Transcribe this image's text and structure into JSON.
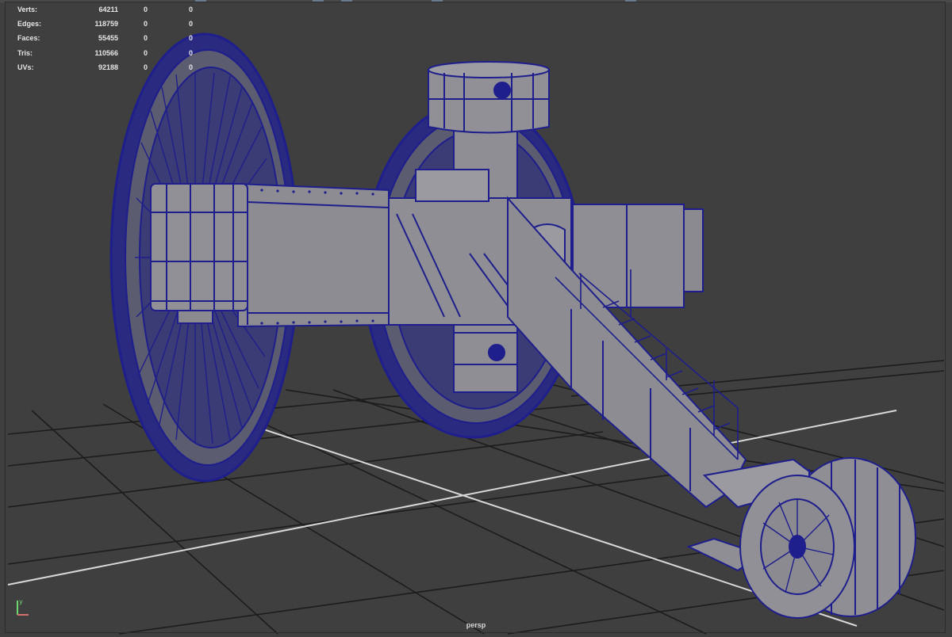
{
  "hud": {
    "rows": [
      {
        "label": "Verts:",
        "v1": "64211",
        "v2": "0",
        "v3": "0"
      },
      {
        "label": "Edges:",
        "v1": "118759",
        "v2": "0",
        "v3": "0"
      },
      {
        "label": "Faces:",
        "v1": "55455",
        "v2": "0",
        "v3": "0"
      },
      {
        "label": "Tris:",
        "v1": "110566",
        "v2": "0",
        "v3": "0"
      },
      {
        "label": "UVs:",
        "v1": "92188",
        "v2": "0",
        "v3": "0"
      }
    ]
  },
  "viewport": {
    "camera_label": "persp",
    "axis_label": "y",
    "background": "#3f3f3f",
    "grid_color": "#1c1c1c",
    "grid_center_color": "#d8d8d8",
    "wire_color": "#1e1e8c",
    "mesh_color": "#8e8e94"
  }
}
